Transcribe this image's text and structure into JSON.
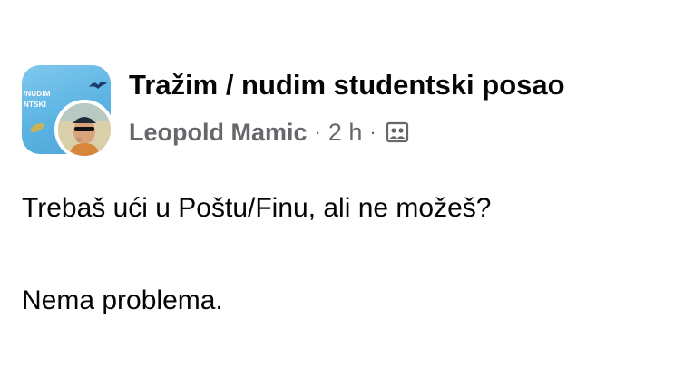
{
  "group": {
    "title": "Tražim / nudim studentski posao",
    "avatar_text_line1": "/NUDIM",
    "avatar_text_line2": "NTSKI"
  },
  "post": {
    "author": "Leopold Mamic",
    "separator": "·",
    "time": "2 h",
    "audience_icon": "group-audience-icon",
    "line1": "Trebaš ući u Poštu/Finu, ali ne možeš?",
    "line2": "Nema problema."
  },
  "colors": {
    "title_text": "#050505",
    "meta_text": "#65676b",
    "avatar_blue": "#5bb3e2",
    "background": "#ffffff"
  }
}
